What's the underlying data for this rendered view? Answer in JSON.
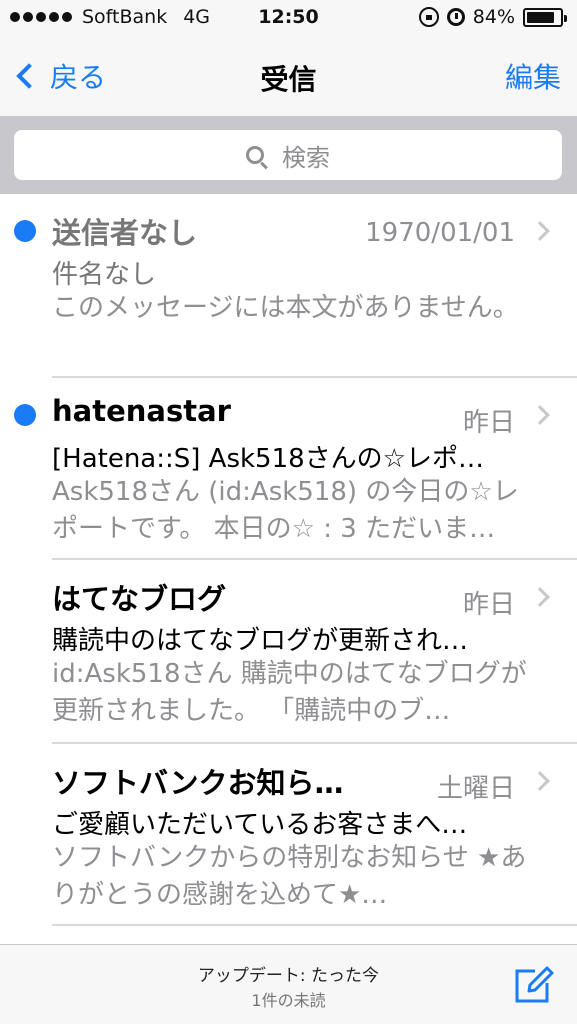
{
  "status_bar": {
    "carrier": "SoftBank",
    "network": "4G",
    "time": "12:50",
    "battery": "84%",
    "battery_level": 0.84,
    "icons": [
      "signal-dots-icon",
      "orientation-lock-icon",
      "alarm-icon",
      "battery-icon"
    ]
  },
  "nav": {
    "back_label": "戻る",
    "title": "受信",
    "edit_label": "編集"
  },
  "search": {
    "placeholder": "検索"
  },
  "messages": [
    {
      "sender": "送信者なし",
      "date": "1970/01/01",
      "subject": "件名なし",
      "preview": "このメッセージには本文がありません。",
      "unread": true
    },
    {
      "sender": "hatenastar",
      "date": "昨日",
      "subject": "[Hatena::S] Ask518さんの☆レポ…",
      "preview": "Ask518さん (id:Ask518) の今日の☆レポートです。 本日の☆ : 3 ただいま…",
      "unread": true
    },
    {
      "sender": "はてなブログ",
      "date": "昨日",
      "subject": "購読中のはてなブログが更新され…",
      "preview": "id:Ask518さん 購読中のはてなブログが更新されました。 「購読中のブ…",
      "unread": false
    },
    {
      "sender": "ソフトバンクお知ら…",
      "date": "土曜日",
      "subject": "ご愛顧いただいているお客さまへ…",
      "preview": "ソフトバンクからの特別なお知らせ ★ありがとうの感謝を込めて★…",
      "unread": false
    }
  ],
  "toolbar": {
    "status": "アップデート: たった今",
    "unread_count": "1件の未読"
  },
  "colors": {
    "accent": "#1a7cf5",
    "bar_background": "#f7f7f7",
    "search_background": "#c7c7cc"
  }
}
